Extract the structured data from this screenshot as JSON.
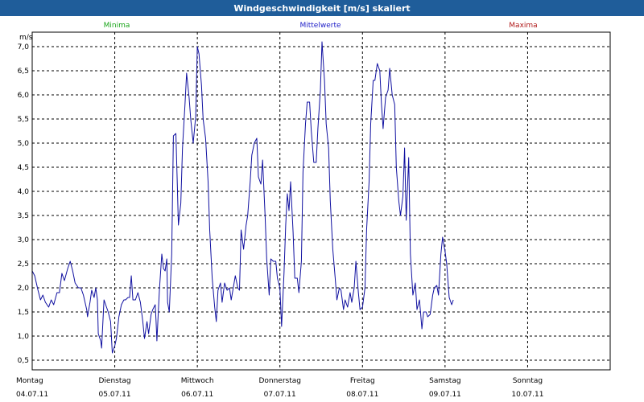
{
  "window": {
    "title": "Windgeschwindigkeit [m/s] skaliert"
  },
  "legend": {
    "minima": {
      "label": "Minima",
      "color": "#1aa51a"
    },
    "mittel": {
      "label": "Mittelwerte",
      "color": "#2020c8"
    },
    "maxima": {
      "label": "Maxima",
      "color": "#b01818"
    }
  },
  "chart_data": {
    "type": "line",
    "title": "Windgeschwindigkeit [m/s] skaliert",
    "unit_label": "m/s",
    "ylim": [
      0.3,
      7.3
    ],
    "yticks": [
      "0,5",
      "1,0",
      "1,5",
      "2,0",
      "2,5",
      "3,0",
      "3,5",
      "4,0",
      "4,5",
      "5,0",
      "5,5",
      "6,0",
      "6,5",
      "7,0"
    ],
    "ytick_values": [
      0.5,
      1.0,
      1.5,
      2.0,
      2.5,
      3.0,
      3.5,
      4.0,
      4.5,
      5.0,
      5.5,
      6.0,
      6.5,
      7.0
    ],
    "xlim": [
      0,
      7
    ],
    "x_unit": "days since Montag 04.07.11 00:00",
    "days": [
      {
        "weekday": "Montag",
        "date": "04.07.11"
      },
      {
        "weekday": "Dienstag",
        "date": "05.07.11"
      },
      {
        "weekday": "Mittwoch",
        "date": "06.07.11"
      },
      {
        "weekday": "Donnerstag",
        "date": "07.07.11"
      },
      {
        "weekday": "Freitag",
        "date": "08.07.11"
      },
      {
        "weekday": "Samstag",
        "date": "09.07.11"
      },
      {
        "weekday": "Sonntag",
        "date": "10.07.11"
      }
    ],
    "grid": true,
    "series": [
      {
        "name": "Mittelwerte",
        "color": "#1010a0",
        "points": [
          [
            0.0,
            2.35
          ],
          [
            0.03,
            2.25
          ],
          [
            0.07,
            1.95
          ],
          [
            0.1,
            1.75
          ],
          [
            0.13,
            1.85
          ],
          [
            0.16,
            1.7
          ],
          [
            0.2,
            1.6
          ],
          [
            0.23,
            1.75
          ],
          [
            0.26,
            1.65
          ],
          [
            0.3,
            1.9
          ],
          [
            0.33,
            1.9
          ],
          [
            0.36,
            2.3
          ],
          [
            0.39,
            2.15
          ],
          [
            0.43,
            2.4
          ],
          [
            0.46,
            2.55
          ],
          [
            0.49,
            2.35
          ],
          [
            0.52,
            2.1
          ],
          [
            0.56,
            2.0
          ],
          [
            0.59,
            2.0
          ],
          [
            0.62,
            1.85
          ],
          [
            0.66,
            1.55
          ],
          [
            0.67,
            1.4
          ],
          [
            0.7,
            1.7
          ],
          [
            0.72,
            1.95
          ],
          [
            0.75,
            1.8
          ],
          [
            0.77,
            2.0
          ],
          [
            0.79,
            1.75
          ],
          [
            0.8,
            1.05
          ],
          [
            0.83,
            0.9
          ],
          [
            0.84,
            0.75
          ],
          [
            0.87,
            1.75
          ],
          [
            0.9,
            1.6
          ],
          [
            0.92,
            1.5
          ],
          [
            0.95,
            1.3
          ],
          [
            0.97,
            0.65
          ],
          [
            1.0,
            0.8
          ],
          [
            1.02,
            0.95
          ],
          [
            1.05,
            1.4
          ],
          [
            1.08,
            1.65
          ],
          [
            1.11,
            1.75
          ],
          [
            1.13,
            1.75
          ],
          [
            1.16,
            1.8
          ],
          [
            1.18,
            1.8
          ],
          [
            1.2,
            2.25
          ],
          [
            1.22,
            1.75
          ],
          [
            1.25,
            1.75
          ],
          [
            1.28,
            1.9
          ],
          [
            1.31,
            1.7
          ],
          [
            1.34,
            1.3
          ],
          [
            1.36,
            0.95
          ],
          [
            1.39,
            1.3
          ],
          [
            1.41,
            1.05
          ],
          [
            1.44,
            1.45
          ],
          [
            1.46,
            1.55
          ],
          [
            1.49,
            1.65
          ],
          [
            1.5,
            1.3
          ],
          [
            1.51,
            0.9
          ],
          [
            1.54,
            1.95
          ],
          [
            1.57,
            2.7
          ],
          [
            1.59,
            2.4
          ],
          [
            1.61,
            2.35
          ],
          [
            1.63,
            2.6
          ],
          [
            1.64,
            1.7
          ],
          [
            1.66,
            1.5
          ],
          [
            1.69,
            2.7
          ],
          [
            1.71,
            5.15
          ],
          [
            1.74,
            5.2
          ],
          [
            1.76,
            4.0
          ],
          [
            1.77,
            3.3
          ],
          [
            1.8,
            3.75
          ],
          [
            1.82,
            4.9
          ],
          [
            1.85,
            5.8
          ],
          [
            1.87,
            6.45
          ],
          [
            1.9,
            5.95
          ],
          [
            1.92,
            5.5
          ],
          [
            1.95,
            5.0
          ],
          [
            1.98,
            5.55
          ],
          [
            2.0,
            7.0
          ],
          [
            2.02,
            6.85
          ],
          [
            2.05,
            6.2
          ],
          [
            2.07,
            5.5
          ],
          [
            2.1,
            5.1
          ],
          [
            2.13,
            4.2
          ],
          [
            2.15,
            3.2
          ],
          [
            2.18,
            2.2
          ],
          [
            2.21,
            1.6
          ],
          [
            2.23,
            1.3
          ],
          [
            2.25,
            1.95
          ],
          [
            2.28,
            2.1
          ],
          [
            2.3,
            1.7
          ],
          [
            2.33,
            2.1
          ],
          [
            2.36,
            1.95
          ],
          [
            2.39,
            2.0
          ],
          [
            2.41,
            1.75
          ],
          [
            2.44,
            2.05
          ],
          [
            2.46,
            2.25
          ],
          [
            2.49,
            2.0
          ],
          [
            2.51,
            1.95
          ],
          [
            2.53,
            3.2
          ],
          [
            2.56,
            2.8
          ],
          [
            2.59,
            3.3
          ],
          [
            2.61,
            3.5
          ],
          [
            2.64,
            4.2
          ],
          [
            2.66,
            4.75
          ],
          [
            2.69,
            5.0
          ],
          [
            2.72,
            5.1
          ],
          [
            2.74,
            4.3
          ],
          [
            2.77,
            4.15
          ],
          [
            2.79,
            4.65
          ],
          [
            2.82,
            3.5
          ],
          [
            2.84,
            2.6
          ],
          [
            2.87,
            1.85
          ],
          [
            2.89,
            2.6
          ],
          [
            2.92,
            2.55
          ],
          [
            2.95,
            2.55
          ],
          [
            2.97,
            2.2
          ],
          [
            3.0,
            2.0
          ],
          [
            3.02,
            1.2
          ],
          [
            3.05,
            2.3
          ],
          [
            3.07,
            3.3
          ],
          [
            3.09,
            3.95
          ],
          [
            3.11,
            3.6
          ],
          [
            3.13,
            4.2
          ],
          [
            3.16,
            3.15
          ],
          [
            3.18,
            2.2
          ],
          [
            3.21,
            2.2
          ],
          [
            3.23,
            1.9
          ],
          [
            3.26,
            2.55
          ],
          [
            3.28,
            4.4
          ],
          [
            3.31,
            5.4
          ],
          [
            3.33,
            5.85
          ],
          [
            3.36,
            5.85
          ],
          [
            3.38,
            5.25
          ],
          [
            3.41,
            4.6
          ],
          [
            3.44,
            4.6
          ],
          [
            3.46,
            5.3
          ],
          [
            3.49,
            6.1
          ],
          [
            3.51,
            7.1
          ],
          [
            3.54,
            6.3
          ],
          [
            3.56,
            5.4
          ],
          [
            3.59,
            4.9
          ],
          [
            3.61,
            3.8
          ],
          [
            3.64,
            2.8
          ],
          [
            3.67,
            2.2
          ],
          [
            3.69,
            1.75
          ],
          [
            3.72,
            2.0
          ],
          [
            3.74,
            1.95
          ],
          [
            3.77,
            1.55
          ],
          [
            3.79,
            1.75
          ],
          [
            3.82,
            1.6
          ],
          [
            3.85,
            1.9
          ],
          [
            3.87,
            1.7
          ],
          [
            3.9,
            2.0
          ],
          [
            3.92,
            2.55
          ],
          [
            3.95,
            1.9
          ],
          [
            3.97,
            1.55
          ],
          [
            4.0,
            1.6
          ],
          [
            4.03,
            2.0
          ],
          [
            4.05,
            3.2
          ],
          [
            4.08,
            4.2
          ],
          [
            4.1,
            5.4
          ],
          [
            4.13,
            6.3
          ],
          [
            4.15,
            6.3
          ],
          [
            4.18,
            6.65
          ],
          [
            4.21,
            6.5
          ],
          [
            4.23,
            5.8
          ],
          [
            4.25,
            5.3
          ],
          [
            4.28,
            5.95
          ],
          [
            4.31,
            6.1
          ],
          [
            4.33,
            6.55
          ],
          [
            4.36,
            6.0
          ],
          [
            4.39,
            5.8
          ],
          [
            4.41,
            4.5
          ],
          [
            4.44,
            3.8
          ],
          [
            4.46,
            3.5
          ],
          [
            4.49,
            3.9
          ],
          [
            4.51,
            4.9
          ],
          [
            4.53,
            3.4
          ],
          [
            4.56,
            4.7
          ],
          [
            4.58,
            2.7
          ],
          [
            4.61,
            1.85
          ],
          [
            4.64,
            2.1
          ],
          [
            4.66,
            1.55
          ],
          [
            4.69,
            1.75
          ],
          [
            4.72,
            1.15
          ],
          [
            4.74,
            1.5
          ],
          [
            4.77,
            1.5
          ],
          [
            4.79,
            1.4
          ],
          [
            4.82,
            1.45
          ],
          [
            4.85,
            1.85
          ],
          [
            4.87,
            2.0
          ],
          [
            4.9,
            2.05
          ],
          [
            4.92,
            1.85
          ],
          [
            4.95,
            2.7
          ],
          [
            4.97,
            3.05
          ],
          [
            5.0,
            2.75
          ],
          [
            5.02,
            2.5
          ],
          [
            5.05,
            1.8
          ],
          [
            5.08,
            1.65
          ],
          [
            5.1,
            1.75
          ]
        ]
      }
    ]
  }
}
